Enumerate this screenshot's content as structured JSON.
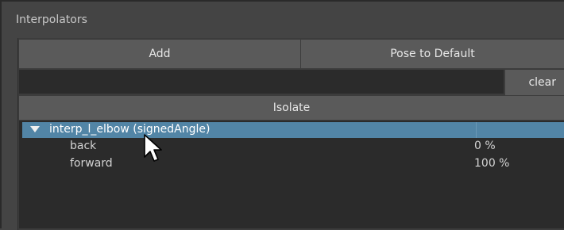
{
  "panel": {
    "title": "Interpolators"
  },
  "toolbar": {
    "add_label": "Add",
    "pose_default_label": "Pose to Default",
    "clear_label": "clear",
    "isolate_label": "Isolate"
  },
  "search": {
    "value": "",
    "placeholder": ""
  },
  "tree": {
    "parent": {
      "label": "interp_l_elbow (signedAngle)",
      "expanded": true,
      "selected": true
    },
    "children": [
      {
        "label": "back",
        "value": "0 %"
      },
      {
        "label": "forward",
        "value": "100 %"
      }
    ]
  },
  "colors": {
    "selection": "#5285a6",
    "button": "#5a5a5a",
    "field": "#2b2b2b"
  },
  "icons": {
    "expand": "triangle-down-icon",
    "cursor": "mouse-pointer-icon"
  }
}
